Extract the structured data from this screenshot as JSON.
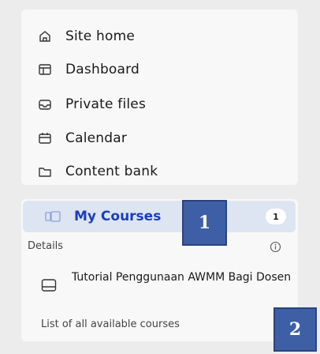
{
  "nav": {
    "items": [
      {
        "label": "Site home",
        "icon": "home-icon"
      },
      {
        "label": "Dashboard",
        "icon": "dashboard-icon"
      },
      {
        "label": "Private files",
        "icon": "inbox-icon"
      },
      {
        "label": "Calendar",
        "icon": "calendar-icon"
      },
      {
        "label": "Content bank",
        "icon": "folder-icon"
      }
    ]
  },
  "courses": {
    "header_label": "My Courses",
    "count": "1",
    "details_label": "Details",
    "course_title": "Tutorial Penggunaan AWMM Bagi Dosen",
    "all_courses_label": "List of all available courses",
    "arrow": "→",
    "accent_color": "#1a3fb8",
    "highlight_bg": "#dde4f2"
  },
  "callouts": {
    "first": "1",
    "second": "2"
  }
}
